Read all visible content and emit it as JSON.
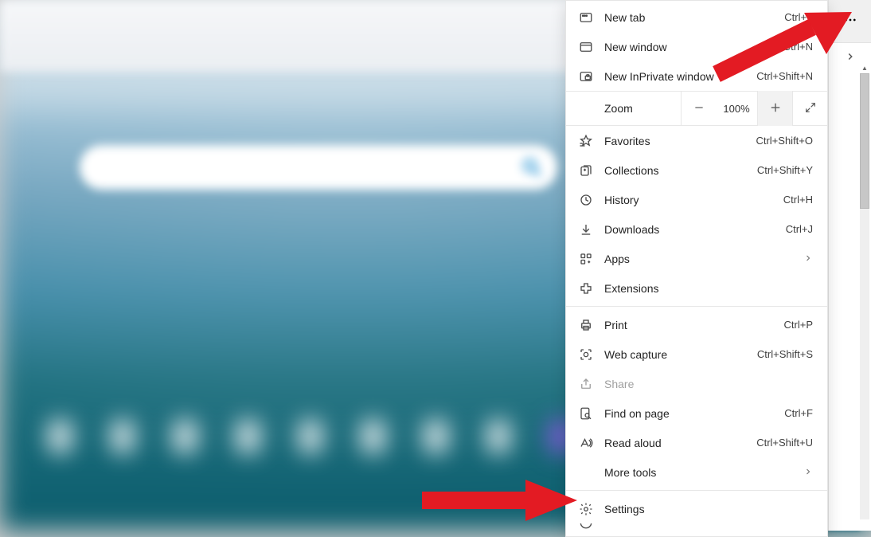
{
  "zoom": {
    "label": "Zoom",
    "value": "100%"
  },
  "menu": {
    "new_tab": {
      "label": "New tab",
      "shortcut": "Ctrl+T"
    },
    "new_window": {
      "label": "New window",
      "shortcut": "Ctrl+N"
    },
    "new_inprivate": {
      "label": "New InPrivate window",
      "shortcut": "Ctrl+Shift+N"
    },
    "favorites": {
      "label": "Favorites",
      "shortcut": "Ctrl+Shift+O"
    },
    "collections": {
      "label": "Collections",
      "shortcut": "Ctrl+Shift+Y"
    },
    "history": {
      "label": "History",
      "shortcut": "Ctrl+H"
    },
    "downloads": {
      "label": "Downloads",
      "shortcut": "Ctrl+J"
    },
    "apps": {
      "label": "Apps"
    },
    "extensions": {
      "label": "Extensions"
    },
    "print": {
      "label": "Print",
      "shortcut": "Ctrl+P"
    },
    "web_capture": {
      "label": "Web capture",
      "shortcut": "Ctrl+Shift+S"
    },
    "share": {
      "label": "Share"
    },
    "find": {
      "label": "Find on page",
      "shortcut": "Ctrl+F"
    },
    "read_aloud": {
      "label": "Read aloud",
      "shortcut": "Ctrl+Shift+U"
    },
    "more_tools": {
      "label": "More tools"
    },
    "settings": {
      "label": "Settings"
    }
  }
}
